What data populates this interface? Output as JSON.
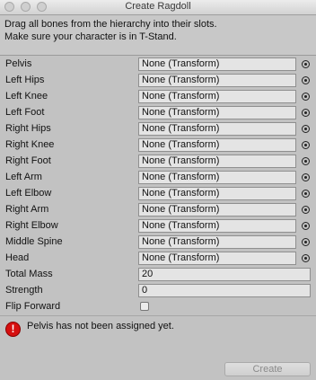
{
  "window": {
    "title": "Create Ragdoll"
  },
  "help": {
    "line1": "Drag all bones from the hierarchy into their slots.",
    "line2": "Make sure your character is in T-Stand."
  },
  "bones": [
    {
      "label": "Pelvis",
      "value": "None (Transform)"
    },
    {
      "label": "Left Hips",
      "value": "None (Transform)"
    },
    {
      "label": "Left Knee",
      "value": "None (Transform)"
    },
    {
      "label": "Left Foot",
      "value": "None (Transform)"
    },
    {
      "label": "Right Hips",
      "value": "None (Transform)"
    },
    {
      "label": "Right Knee",
      "value": "None (Transform)"
    },
    {
      "label": "Right Foot",
      "value": "None (Transform)"
    },
    {
      "label": "Left Arm",
      "value": "None (Transform)"
    },
    {
      "label": "Left Elbow",
      "value": "None (Transform)"
    },
    {
      "label": "Right Arm",
      "value": "None (Transform)"
    },
    {
      "label": "Right Elbow",
      "value": "None (Transform)"
    },
    {
      "label": "Middle Spine",
      "value": "None (Transform)"
    },
    {
      "label": "Head",
      "value": "None (Transform)"
    }
  ],
  "total_mass": {
    "label": "Total Mass",
    "value": "20"
  },
  "strength": {
    "label": "Strength",
    "value": "0"
  },
  "flip_forward": {
    "label": "Flip Forward",
    "checked": false
  },
  "message": {
    "icon": "error-icon",
    "text": "Pelvis has not been assigned yet."
  },
  "create_button": {
    "label": "Create",
    "enabled": false
  },
  "colors": {
    "error": "#d60f0f",
    "background": "#c2c2c2",
    "field": "#e4e4e4"
  }
}
